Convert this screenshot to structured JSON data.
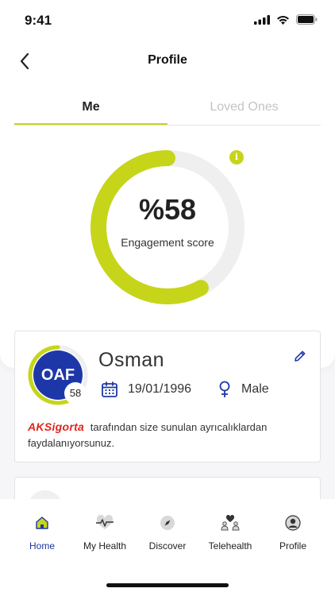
{
  "status_bar": {
    "time": "9:41"
  },
  "nav": {
    "title": "Profile"
  },
  "tabs": [
    {
      "label": "Me",
      "active": true
    },
    {
      "label": "Loved Ones",
      "active": false
    }
  ],
  "engagement": {
    "value_text": "%58",
    "label": "Engagement score",
    "percent": 58,
    "info_icon": "i"
  },
  "profile": {
    "initials": "OAF",
    "score": "58",
    "name": "Osman",
    "birth_date": "19/01/1996",
    "gender": "Male",
    "sponsor_brand": "AKSigorta",
    "sponsor_text": "tarafından size sunulan ayrıcalıklardan faydalanıyorsunuz."
  },
  "bottom_nav": [
    {
      "label": "Home",
      "icon": "home-icon",
      "active": true
    },
    {
      "label": "My Health",
      "icon": "heart-pulse-icon",
      "active": false
    },
    {
      "label": "Discover",
      "icon": "compass-icon",
      "active": false
    },
    {
      "label": "Telehealth",
      "icon": "telehealth-icon",
      "active": false
    },
    {
      "label": "Profile",
      "icon": "profile-icon",
      "active": false
    }
  ],
  "colors": {
    "accent": "#c6d51a",
    "primary": "#1e37a8",
    "track": "#efefef",
    "brand_red": "#e0241b"
  }
}
